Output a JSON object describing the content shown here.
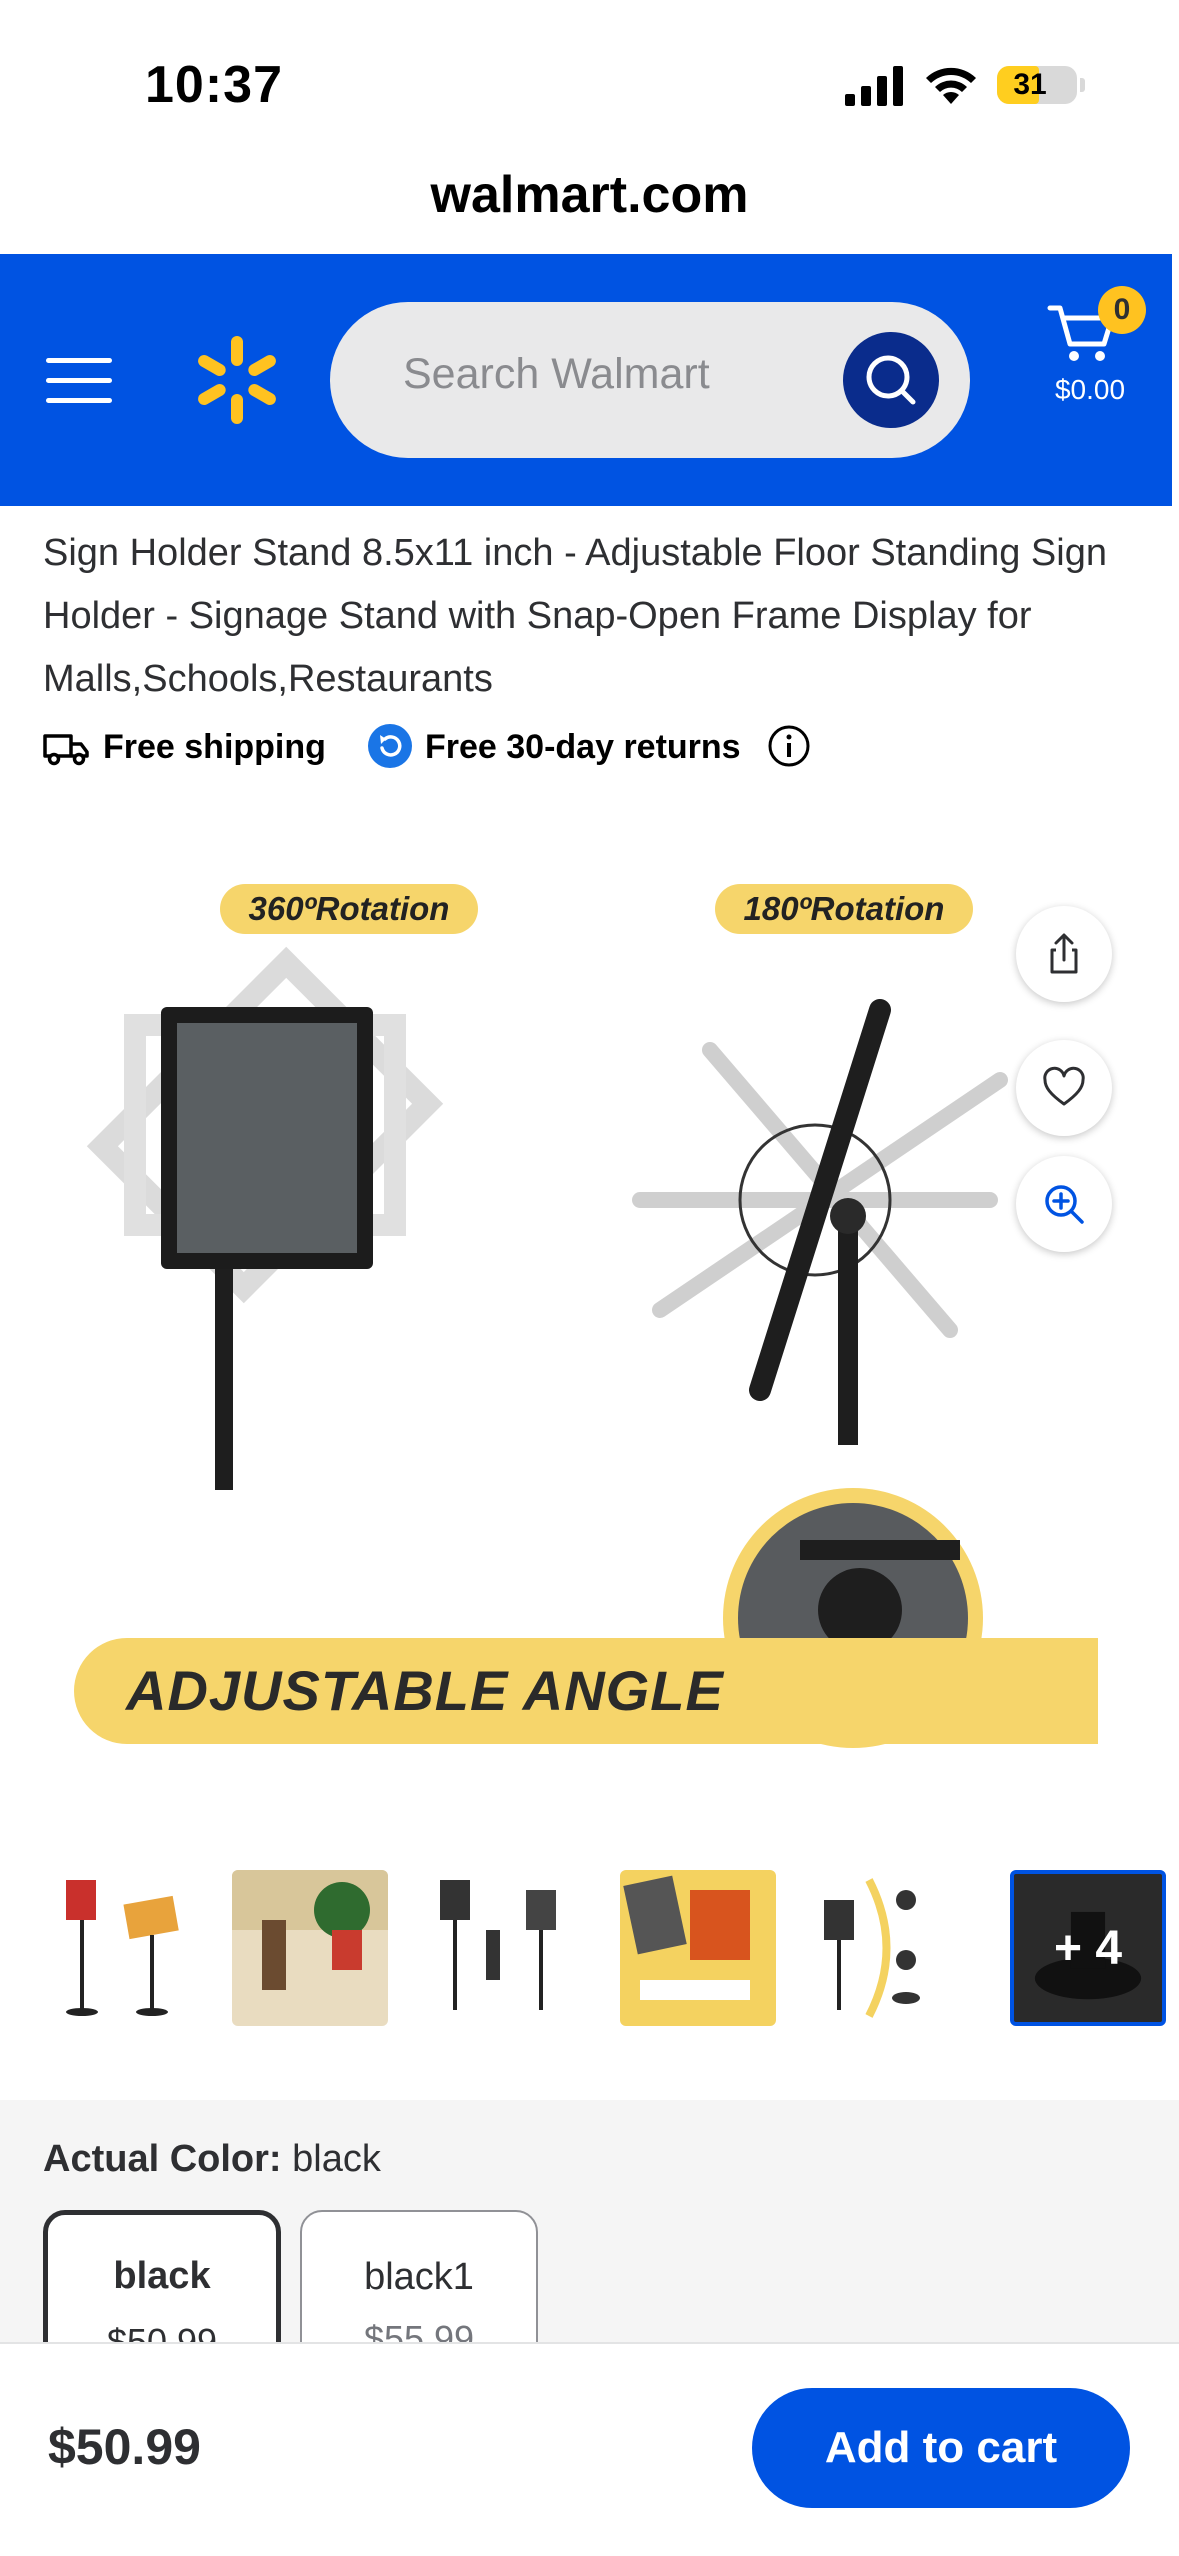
{
  "status_bar": {
    "time": "10:37",
    "battery": "31"
  },
  "browser": {
    "url": "walmart.com"
  },
  "header": {
    "search_placeholder": "Search Walmart",
    "cart_count": "0",
    "cart_total": "$0.00",
    "brand_color": "#0053e2",
    "spark_color": "#ffc220"
  },
  "product": {
    "title": "Sign Holder Stand 8.5x11 inch - Adjustable Floor Standing Sign Holder - Signage Stand with Snap-Open Frame Display for Malls,Schools,Restaurants",
    "shipping": "Free shipping",
    "returns": "Free 30-day returns"
  },
  "hero_image": {
    "label_left": "360ºRotation",
    "label_right": "180ºRotation",
    "banner": "ADJUSTABLE ANGLE"
  },
  "gallery": {
    "thumbnail_count": 6,
    "more_label": "+ 4"
  },
  "actions": [
    "share-icon",
    "heart-icon",
    "zoom-in-icon"
  ],
  "variant": {
    "label": "Actual Color:",
    "value": "black",
    "options": [
      {
        "name": "black",
        "price": "$50.99",
        "selected": true
      },
      {
        "name": "black1",
        "price": "$55.99",
        "selected": false
      }
    ]
  },
  "footer": {
    "price": "$50.99",
    "add_to_cart": "Add to cart"
  }
}
